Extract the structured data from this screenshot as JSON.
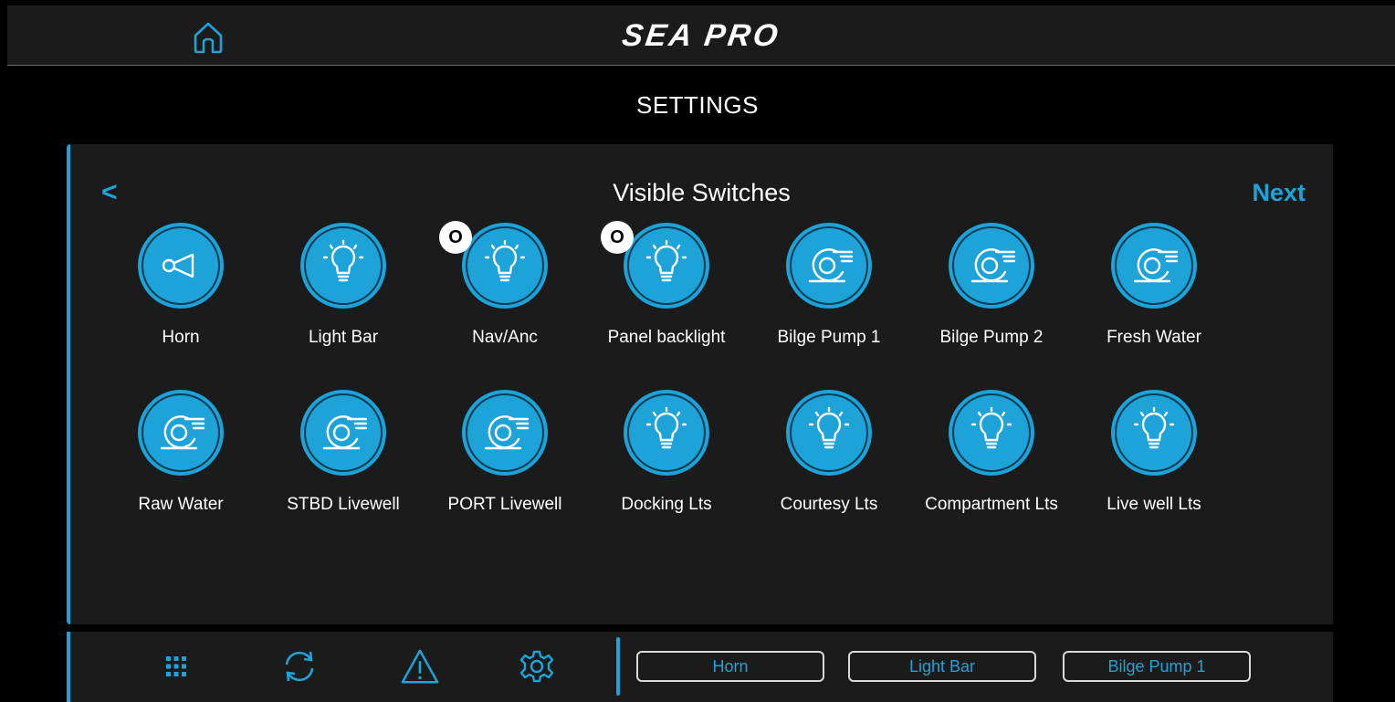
{
  "header": {
    "brand": "SEA PRO"
  },
  "page": {
    "title": "SETTINGS"
  },
  "panel": {
    "title": "Visible Switches",
    "back_label": "<",
    "next_label": "Next"
  },
  "switches": [
    {
      "label": "Horn",
      "icon": "horn-icon"
    },
    {
      "label": "Light Bar",
      "icon": "bulb-icon"
    },
    {
      "label": "Nav/Anc",
      "icon": "bulb-icon",
      "badge": "O"
    },
    {
      "label": "Panel backlight",
      "icon": "bulb-icon",
      "badge": "O"
    },
    {
      "label": "Bilge Pump 1",
      "icon": "pump-icon"
    },
    {
      "label": "Bilge Pump 2",
      "icon": "pump-icon"
    },
    {
      "label": "Fresh Water",
      "icon": "pump-icon"
    },
    {
      "label": "Raw Water",
      "icon": "pump-icon"
    },
    {
      "label": "STBD Livewell",
      "icon": "pump-icon"
    },
    {
      "label": "PORT Livewell",
      "icon": "pump-icon"
    },
    {
      "label": "Docking Lts",
      "icon": "bulb-icon"
    },
    {
      "label": "Courtesy Lts",
      "icon": "bulb-icon"
    },
    {
      "label": "Compartment Lts",
      "icon": "bulb-icon"
    },
    {
      "label": "Live well Lts",
      "icon": "bulb-icon"
    }
  ],
  "bottom_bar": {
    "icons": [
      "grid-icon",
      "sync-icon",
      "warning-icon",
      "gear-icon"
    ],
    "quick_switches": [
      "Horn",
      "Light Bar",
      "Bilge Pump 1"
    ]
  },
  "colors": {
    "accent": "#1da3d8",
    "panel": "#1b1b1b",
    "background": "#000000"
  }
}
